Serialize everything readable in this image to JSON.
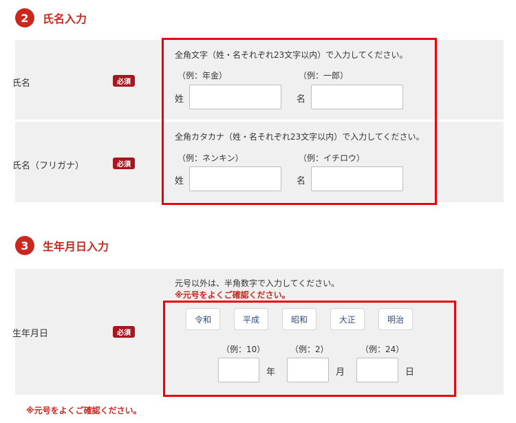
{
  "section2": {
    "number": "2",
    "title": "氏名入力",
    "name_row": {
      "label": "氏名",
      "required": "必須",
      "instruction": "全角文字（姓・名それぞれ23文字以内）で入力してください。",
      "sei_example": "（例：年金）",
      "mei_example": "（例：一郎）",
      "sei_label": "姓",
      "mei_label": "名",
      "sei_value": "",
      "mei_value": ""
    },
    "kana_row": {
      "label": "氏名（フリガナ）",
      "required": "必須",
      "instruction": "全角カタカナ（姓・名それぞれ23文字以内）で入力してください。",
      "sei_example": "（例：ネンキン）",
      "mei_example": "（例：イチロウ）",
      "sei_label": "姓",
      "mei_label": "名",
      "sei_value": "",
      "mei_value": ""
    }
  },
  "section3": {
    "number": "3",
    "title": "生年月日入力",
    "birth_row": {
      "label": "生年月日",
      "required": "必須",
      "instruction": "元号以外は、半角数字で入力してください。",
      "warning": "※元号をよくご確認ください。",
      "eras": [
        "令和",
        "平成",
        "昭和",
        "大正",
        "明治"
      ],
      "year_example": "（例：10）",
      "month_example": "（例：2）",
      "day_example": "（例：24）",
      "year_unit": "年",
      "month_unit": "月",
      "day_unit": "日",
      "year_value": "",
      "month_value": "",
      "day_value": ""
    }
  },
  "bottom_warning": "※元号をよくご確認ください。",
  "colors": {
    "accent": "#c9281e",
    "required_badge": "#a8171f",
    "highlight_border": "#e8000b",
    "row_bg": "#f0f0f0"
  }
}
